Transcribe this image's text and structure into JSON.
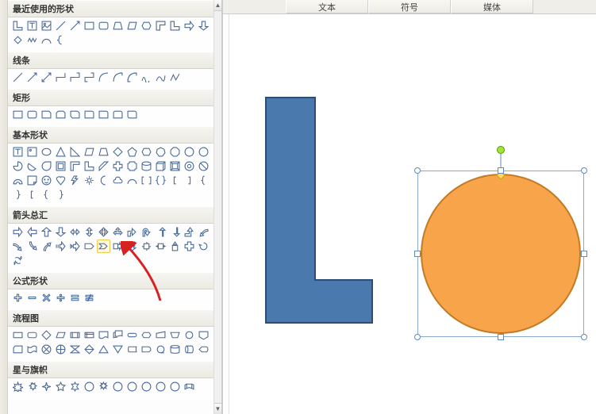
{
  "tabs": {
    "text": "文本",
    "symbol": "符号",
    "media": "媒体"
  },
  "categories": {
    "recent": {
      "title": "最近使用的形状"
    },
    "lines": {
      "title": "线条"
    },
    "rects": {
      "title": "矩形"
    },
    "basic": {
      "title": "基本形状"
    },
    "arrows": {
      "title": "箭头总汇"
    },
    "formula": {
      "title": "公式形状"
    },
    "flowchart": {
      "title": "流程图"
    },
    "stars": {
      "title": "星与旗帜"
    }
  },
  "highlighted_shape_name": "arrow-chevron-icon",
  "canvas": {
    "L_shape": {
      "fill": "#4a79ad",
      "stroke": "#2d4d72"
    },
    "ellipse": {
      "fill": "#f8a44b",
      "stroke": "#c37a24",
      "selected": true
    }
  },
  "colors": {
    "shape_stroke": "#4a6a9a",
    "selection": "#5c8ac0",
    "rotation_handle": "#a6e23b",
    "adjust_handle": "#ffd766"
  }
}
